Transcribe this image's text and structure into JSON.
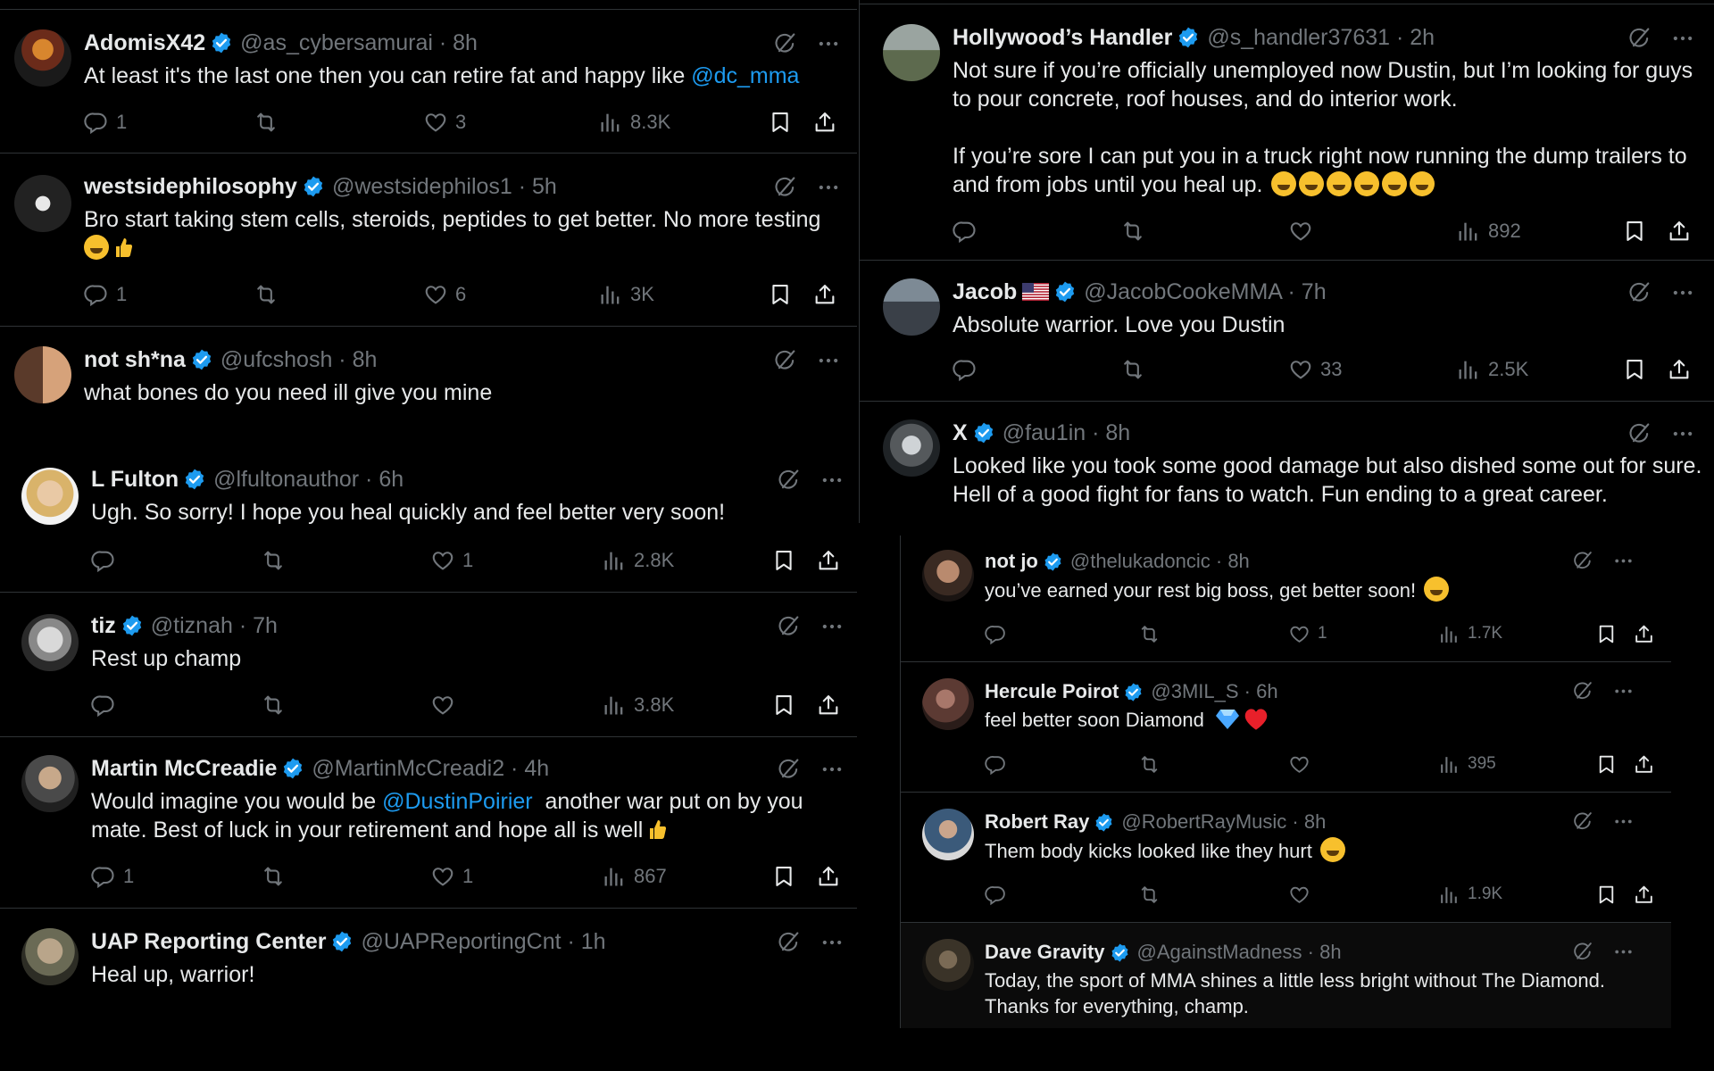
{
  "colors": {
    "background": "#000000",
    "text": "#e7e9ea",
    "muted": "#71767b",
    "accent": "#1d9bf0",
    "divider": "#2f3336"
  },
  "left": [
    {
      "name": "AdomisX42",
      "handle": "@as_cybersamurai",
      "sep": " · ",
      "time": "8h",
      "line1": "At least it's the last one then you can retire fat and happy like ",
      "mention": "@dc_mma",
      "line2": "",
      "reply": "1",
      "repost": "",
      "like": "3",
      "views": "8.3K"
    },
    {
      "name": "westsidephilosophy",
      "handle": "@westsidephilos1",
      "sep": " · ",
      "time": "5h",
      "line1": "Bro start taking stem cells, steroids, peptides to get better. No more testing",
      "line2": "",
      "reply": "1",
      "repost": "",
      "like": "6",
      "views": "3K"
    },
    {
      "name": "not sh*na",
      "handle": "@ufcshosh",
      "sep": " · ",
      "time": "8h",
      "line1": "what bones do you need ill give you mine"
    },
    {
      "name": "L Fulton",
      "handle": "@lfultonauthor",
      "sep": " · ",
      "time": "6h",
      "line1": "Ugh. So sorry! I hope you heal quickly and feel better very soon!",
      "reply": "",
      "repost": "",
      "like": "1",
      "views": "2.8K"
    },
    {
      "name": "tiz",
      "handle": "@tiznah",
      "sep": " · ",
      "time": "7h",
      "line1": "Rest up champ",
      "reply": "",
      "repost": "",
      "like": "",
      "views": "3.8K"
    },
    {
      "name": "Martin McCreadie",
      "handle": "@MartinMcCreadi2",
      "sep": " · ",
      "time": "4h",
      "line1a": "Would imagine you would be ",
      "mention": "@DustinPoirier",
      "line1b": "  another war put on by you",
      "line2": "mate. Best of luck in your retirement and hope all is well",
      "reply": "1",
      "repost": "",
      "like": "1",
      "views": "867"
    },
    {
      "name": "UAP Reporting Center",
      "handle": "@UAPReportingCnt",
      "sep": " · ",
      "time": "1h",
      "line1": "Heal up, warrior!"
    }
  ],
  "right": [
    {
      "name": "Hollywood’s Handler",
      "handle": "@s_handler37631",
      "sep": " · ",
      "time": "2h",
      "line1": "Not sure if you’re officially unemployed now Dustin, but I’m looking for guys",
      "line2": "to pour concrete, roof houses, and do interior work.",
      "line3": "If you’re sore I can put you in a truck right now running the dump trailers to",
      "line4": "and from jobs until you heal up. ",
      "reply": "",
      "repost": "",
      "like": "",
      "views": "892"
    },
    {
      "name": "Jacob",
      "handle": "@JacobCookeMMA",
      "sep": " · ",
      "time": "7h",
      "line1": "Absolute warrior. Love you Dustin",
      "reply": "",
      "repost": "",
      "like": "33",
      "views": "2.5K"
    },
    {
      "name": "X",
      "handle": "@fau1in",
      "sep": " · ",
      "time": "8h",
      "line1": "Looked like you took some good damage but also dished some out for sure.",
      "line2": "Hell of a good fight for fans to watch. Fun ending to a great career."
    }
  ],
  "right2": [
    {
      "name": "not jo",
      "handle": "@thelukadoncic",
      "sep": " · ",
      "time": "8h",
      "line1": "you’ve earned your rest big boss, get better soon! ",
      "reply": "",
      "repost": "",
      "like": "1",
      "views": "1.7K"
    },
    {
      "name": "Hercule Poirot",
      "handle": "@3MIL_S",
      "sep": " · ",
      "time": "6h",
      "line1": "feel better soon Diamond ",
      "reply": "",
      "repost": "",
      "like": "",
      "views": "395"
    },
    {
      "name": "Robert Ray",
      "handle": "@RobertRayMusic",
      "sep": " · ",
      "time": "8h",
      "line1": "Them body kicks looked like they hurt ",
      "reply": "",
      "repost": "",
      "like": "",
      "views": "1.9K"
    },
    {
      "name": "Dave Gravity",
      "handle": "@AgainstMadness",
      "sep": " · ",
      "time": "8h",
      "line1": "Today, the sport of MMA shines a little less bright without The Diamond.",
      "line2": "Thanks for everything, champ."
    }
  ]
}
